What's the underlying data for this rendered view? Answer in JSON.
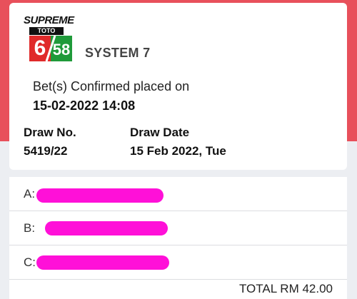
{
  "header": {
    "logo_brand": "SUPREME",
    "logo_toto": "TOTO",
    "logo_six": "6",
    "logo_fiftyeight": "58",
    "system": "SYSTEM 7",
    "confirm_label": "Bet(s) Confirmed placed on",
    "confirm_time": "15-02-2022 14:08",
    "draw_no_label": "Draw No.",
    "draw_no": "5419/22",
    "draw_date_label": "Draw Date",
    "draw_date": "15 Feb 2022, Tue"
  },
  "bets": [
    {
      "label": "A:"
    },
    {
      "label": "B: "
    },
    {
      "label": "C: "
    }
  ],
  "footer": {
    "total": "TOTAL RM 42.00"
  },
  "colors": {
    "accent": "#e8505b",
    "redaction": "#ff10d8",
    "logo_red": "#e02a2a",
    "logo_green": "#1f9a3a"
  }
}
